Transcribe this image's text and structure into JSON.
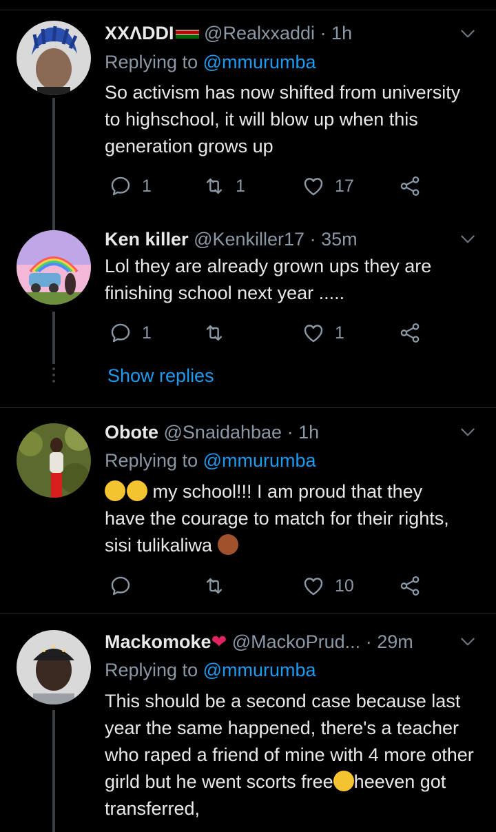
{
  "tweets": [
    {
      "name": "XXΛDDI",
      "handle": "@Realxxaddi",
      "time": "· 1h",
      "replying_prefix": "Replying to ",
      "replying_to": "@mmurumba",
      "text": "So activism has now shifted from university to highschool, it will blow up when this generation grows up",
      "replies": "1",
      "retweets": "1",
      "likes": "17"
    },
    {
      "name": "Ken killer",
      "handle": "@Kenkiller17",
      "time": "· 35m",
      "text": "Lol they are already grown ups they are finishing school next year .....",
      "replies": "1",
      "retweets": "",
      "likes": "1",
      "show_replies": "Show replies"
    },
    {
      "name": "Obote",
      "handle": "@Snaidahbae",
      "time": "· 1h",
      "replying_prefix": "Replying to ",
      "replying_to": "@mmurumba",
      "text_line1": " my school!!! I am proud that they",
      "text_rest": "have the courage to match for their rights, sisi tulikaliwa",
      "replies": "",
      "retweets": "",
      "likes": "10"
    },
    {
      "name": "Mackomoke",
      "handle": "@MackoPrud...",
      "time": "· 29m",
      "replying_prefix": "Replying to ",
      "replying_to": "@mmurumba",
      "text_a": "This should be a second case because last year the same happened, there's a teacher who raped a friend of mine with 4 more other girld but he went scorts free",
      "text_b": "heeven got transferred,"
    }
  ],
  "icons": {
    "reply": "reply-icon",
    "retweet": "retweet-icon",
    "like": "heart-icon",
    "share": "share-icon",
    "more": "chevron-down-icon"
  },
  "colors": {
    "background": "#000000",
    "link": "#1d9bf0",
    "secondary": "#8b98a5",
    "text": "#e7e9ea"
  }
}
